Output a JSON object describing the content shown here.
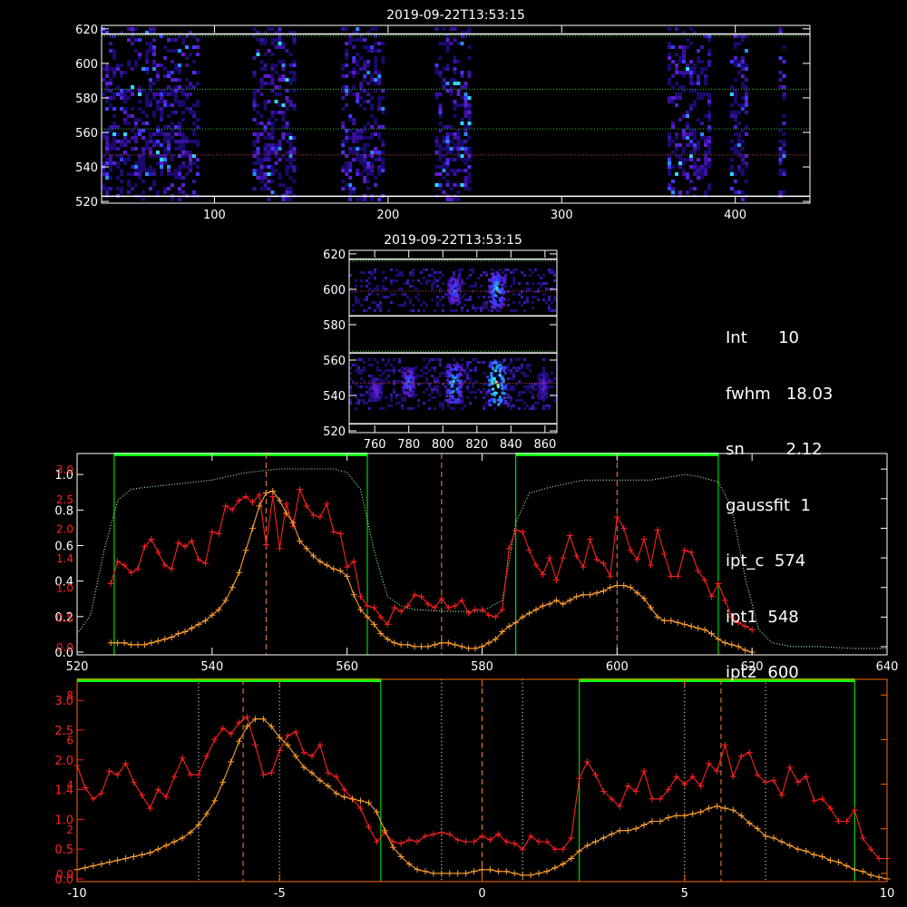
{
  "colors": {
    "background": "#000000",
    "axes": "#ffffff",
    "axes_bottom": "#ff6a00",
    "profile_red": "#ff2020",
    "profile_orange": "#ffa030",
    "guide_green": "#00ff00",
    "spectrum_green": "#b0ffb0",
    "center_line": "#ff8040"
  },
  "chart_data": [
    {
      "id": "image-wide",
      "type": "heatmap",
      "title": "2019-09-22T13:53:15",
      "xlim": [
        35,
        443
      ],
      "ylim": [
        519,
        622
      ],
      "xticks": [
        100,
        200,
        300,
        400
      ],
      "yticks": [
        520,
        540,
        560,
        580,
        600,
        620
      ],
      "colormap": [
        "#1a0a6e",
        "#5a1ed0",
        "#3c3cff",
        "#2aa0ff",
        "#40ffff",
        "#c0ff60"
      ],
      "bands_x": [
        [
          35,
          90
        ],
        [
          122,
          146
        ],
        [
          173,
          198
        ],
        [
          227,
          246
        ],
        [
          361,
          386
        ],
        [
          397,
          406
        ],
        [
          425,
          429
        ]
      ],
      "bands_y": [
        [
          522,
          616
        ]
      ],
      "dotted_rows_y": [
        616,
        585,
        562,
        547
      ],
      "white_rows_y": [
        617,
        523
      ]
    },
    {
      "id": "image-zoom",
      "type": "heatmap",
      "title": "2019-09-22T13:53:15",
      "xlim": [
        745,
        867
      ],
      "ylim": [
        519,
        622
      ],
      "xticks": [
        760,
        780,
        800,
        820,
        840,
        860
      ],
      "yticks": [
        520,
        540,
        560,
        580,
        600,
        620
      ],
      "blobs": [
        {
          "x": 831,
          "y": 548,
          "w": 6,
          "h": 16,
          "level": 5
        },
        {
          "x": 806,
          "y": 547,
          "w": 5,
          "h": 14,
          "level": 4
        },
        {
          "x": 831,
          "y": 600,
          "w": 5,
          "h": 12,
          "level": 4
        },
        {
          "x": 806,
          "y": 600,
          "w": 4,
          "h": 10,
          "level": 3
        },
        {
          "x": 779,
          "y": 548,
          "w": 4,
          "h": 10,
          "level": 3
        },
        {
          "x": 858,
          "y": 546,
          "w": 3,
          "h": 9,
          "level": 2
        },
        {
          "x": 760,
          "y": 544,
          "w": 4,
          "h": 8,
          "level": 2
        }
      ],
      "dotted_rows_y": [
        616,
        599,
        585,
        565,
        547
      ],
      "white_rows_y": [
        617,
        585,
        564,
        524
      ]
    },
    {
      "id": "profile-pixel",
      "type": "line",
      "xlim": [
        520,
        640
      ],
      "xticks": [
        520,
        540,
        560,
        580,
        600,
        620,
        640
      ],
      "ylim_left": [
        0,
        1.0
      ],
      "yticks_left": [
        "0.0",
        "0.2",
        "0.4",
        "0.6",
        "0.8",
        "1.0"
      ],
      "yticks_red": [
        "0.0",
        "0.5",
        "1.0",
        "1.4",
        "2.0",
        "2.5",
        "3.0"
      ],
      "vlines": [
        548,
        574,
        600
      ],
      "green_windows": [
        [
          525.5,
          563
        ],
        [
          585,
          615
        ]
      ],
      "green_curve": {
        "x": [
          520,
          522,
          524,
          526,
          528,
          530,
          535,
          540,
          545,
          550,
          555,
          558,
          560,
          562,
          564,
          566,
          568,
          570,
          575,
          580,
          583,
          585,
          587,
          590,
          595,
          600,
          605,
          610,
          612,
          615,
          617,
          619,
          621,
          623,
          626,
          630,
          635,
          640
        ],
        "y": [
          0.1,
          0.2,
          0.55,
          0.82,
          0.88,
          0.89,
          0.91,
          0.93,
          0.97,
          0.99,
          0.99,
          0.99,
          0.97,
          0.88,
          0.55,
          0.3,
          0.25,
          0.23,
          0.22,
          0.22,
          0.28,
          0.7,
          0.86,
          0.89,
          0.93,
          0.93,
          0.93,
          0.96,
          0.95,
          0.92,
          0.78,
          0.4,
          0.12,
          0.05,
          0.03,
          0.03,
          0.02,
          0.02
        ]
      },
      "series_red": {
        "x": [
          525,
          526,
          527,
          528,
          529,
          530,
          531,
          532,
          533,
          534,
          535,
          536,
          537,
          538,
          539,
          540,
          541,
          542,
          543,
          544,
          545,
          546,
          547,
          548,
          549,
          550,
          551,
          552,
          553,
          554,
          555,
          556,
          557,
          558,
          559,
          560,
          561,
          562,
          563,
          564,
          565,
          566,
          567,
          568,
          569,
          570,
          571,
          572,
          573,
          574,
          575,
          576,
          577,
          578,
          579,
          580,
          581,
          582,
          583,
          584,
          585,
          586,
          587,
          588,
          589,
          590,
          591,
          592,
          593,
          594,
          595,
          596,
          597,
          598,
          599,
          600,
          601,
          602,
          603,
          604,
          605,
          606,
          607,
          608,
          609,
          610,
          611,
          612,
          613,
          614,
          615,
          616,
          617,
          618,
          619,
          620
        ],
        "y": [
          0.37,
          0.49,
          0.47,
          0.43,
          0.45,
          0.57,
          0.61,
          0.54,
          0.47,
          0.45,
          0.59,
          0.57,
          0.6,
          0.5,
          0.48,
          0.65,
          0.64,
          0.79,
          0.77,
          0.82,
          0.84,
          0.81,
          0.85,
          0.58,
          0.84,
          0.56,
          0.8,
          0.68,
          0.88,
          0.79,
          0.74,
          0.73,
          0.8,
          0.65,
          0.64,
          0.46,
          0.49,
          0.3,
          0.25,
          0.24,
          0.19,
          0.15,
          0.24,
          0.22,
          0.25,
          0.31,
          0.3,
          0.26,
          0.24,
          0.29,
          0.24,
          0.25,
          0.28,
          0.21,
          0.23,
          0.23,
          0.2,
          0.19,
          0.23,
          0.56,
          0.66,
          0.65,
          0.55,
          0.47,
          0.42,
          0.51,
          0.39,
          0.51,
          0.63,
          0.52,
          0.46,
          0.61,
          0.5,
          0.48,
          0.41,
          0.73,
          0.67,
          0.55,
          0.5,
          0.61,
          0.47,
          0.66,
          0.53,
          0.41,
          0.41,
          0.55,
          0.54,
          0.44,
          0.39,
          0.3,
          0.37,
          0.28,
          0.19,
          0.16,
          0.14,
          0.12
        ]
      },
      "series_orange": {
        "x": [
          525,
          526,
          527,
          528,
          529,
          530,
          531,
          532,
          533,
          534,
          535,
          536,
          537,
          538,
          539,
          540,
          541,
          542,
          543,
          544,
          545,
          546,
          547,
          548,
          549,
          550,
          551,
          552,
          553,
          554,
          555,
          556,
          557,
          558,
          559,
          560,
          561,
          562,
          563,
          564,
          565,
          566,
          567,
          568,
          569,
          570,
          571,
          572,
          573,
          574,
          575,
          576,
          577,
          578,
          579,
          580,
          581,
          582,
          583,
          584,
          585,
          586,
          587,
          588,
          589,
          590,
          591,
          592,
          593,
          594,
          595,
          596,
          597,
          598,
          599,
          600,
          601,
          602,
          603,
          604,
          605,
          606,
          607,
          608,
          609,
          610,
          611,
          612,
          613,
          614,
          615,
          616,
          617,
          618,
          619,
          620
        ],
        "y": [
          0.05,
          0.05,
          0.05,
          0.04,
          0.04,
          0.04,
          0.05,
          0.06,
          0.07,
          0.08,
          0.1,
          0.11,
          0.13,
          0.15,
          0.17,
          0.2,
          0.23,
          0.28,
          0.35,
          0.43,
          0.55,
          0.67,
          0.79,
          0.86,
          0.87,
          0.82,
          0.75,
          0.7,
          0.6,
          0.56,
          0.52,
          0.49,
          0.47,
          0.45,
          0.44,
          0.41,
          0.31,
          0.23,
          0.19,
          0.15,
          0.1,
          0.07,
          0.05,
          0.04,
          0.04,
          0.03,
          0.03,
          0.03,
          0.04,
          0.05,
          0.05,
          0.04,
          0.03,
          0.02,
          0.02,
          0.03,
          0.05,
          0.07,
          0.11,
          0.14,
          0.16,
          0.19,
          0.21,
          0.23,
          0.25,
          0.26,
          0.28,
          0.26,
          0.28,
          0.3,
          0.31,
          0.31,
          0.32,
          0.33,
          0.35,
          0.36,
          0.36,
          0.35,
          0.32,
          0.29,
          0.24,
          0.19,
          0.17,
          0.17,
          0.16,
          0.15,
          0.14,
          0.13,
          0.12,
          0.1,
          0.07,
          0.05,
          0.04,
          0.03,
          0.01,
          0.0
        ]
      }
    },
    {
      "id": "profile-arcsec",
      "type": "line",
      "xlim": [
        -10,
        10
      ],
      "xticks": [
        -10,
        -5,
        0,
        5,
        10
      ],
      "yticks_left": [
        "0.0",
        "0.5",
        "1.0",
        "1.4",
        "2.0",
        "2.5",
        "3.0"
      ],
      "yticks_red": [
        "0.0",
        "2",
        "4",
        "6",
        "8"
      ],
      "vlines_dashed": [
        -5.9,
        0,
        5.9
      ],
      "vlines_dotted": [
        -7,
        -5,
        -1,
        1,
        5,
        7
      ],
      "green_windows": [
        [
          -10,
          -2.5
        ],
        [
          2.4,
          9.2
        ]
      ],
      "series_red": {
        "x": [
          -10.0,
          -9.8,
          -9.6,
          -9.4,
          -9.2,
          -9.0,
          -8.8,
          -8.6,
          -8.4,
          -8.2,
          -8.0,
          -7.8,
          -7.6,
          -7.4,
          -7.2,
          -7.0,
          -6.8,
          -6.6,
          -6.4,
          -6.2,
          -6.0,
          -5.8,
          -5.6,
          -5.4,
          -5.2,
          -5.0,
          -4.8,
          -4.6,
          -4.4,
          -4.2,
          -4.0,
          -3.8,
          -3.6,
          -3.4,
          -3.2,
          -3.0,
          -2.8,
          -2.6,
          -2.4,
          -2.2,
          -2.0,
          -1.8,
          -1.6,
          -1.4,
          -1.2,
          -1.0,
          -0.8,
          -0.6,
          -0.4,
          -0.2,
          0.0,
          0.2,
          0.4,
          0.6,
          0.8,
          1.0,
          1.2,
          1.4,
          1.6,
          1.8,
          2.0,
          2.2,
          2.4,
          2.6,
          2.8,
          3.0,
          3.2,
          3.4,
          3.6,
          3.8,
          4.0,
          4.2,
          4.4,
          4.6,
          4.8,
          5.0,
          5.2,
          5.4,
          5.6,
          5.8,
          6.0,
          6.2,
          6.4,
          6.6,
          6.8,
          7.0,
          7.2,
          7.4,
          7.6,
          7.8,
          8.0,
          8.2,
          8.4,
          8.6,
          8.8,
          9.0,
          9.2,
          9.4,
          9.6,
          9.8,
          10.0
        ],
        "y": [
          0.61,
          0.49,
          0.43,
          0.46,
          0.58,
          0.56,
          0.62,
          0.52,
          0.45,
          0.38,
          0.48,
          0.44,
          0.55,
          0.65,
          0.56,
          0.56,
          0.66,
          0.75,
          0.81,
          0.78,
          0.84,
          0.87,
          0.72,
          0.56,
          0.57,
          0.69,
          0.77,
          0.79,
          0.68,
          0.66,
          0.72,
          0.57,
          0.55,
          0.48,
          0.43,
          0.38,
          0.28,
          0.2,
          0.25,
          0.2,
          0.19,
          0.21,
          0.2,
          0.23,
          0.24,
          0.25,
          0.24,
          0.21,
          0.2,
          0.2,
          0.23,
          0.21,
          0.24,
          0.2,
          0.19,
          0.16,
          0.23,
          0.2,
          0.2,
          0.16,
          0.16,
          0.22,
          0.54,
          0.63,
          0.56,
          0.47,
          0.43,
          0.39,
          0.5,
          0.47,
          0.58,
          0.43,
          0.43,
          0.48,
          0.55,
          0.51,
          0.55,
          0.5,
          0.62,
          0.58,
          0.72,
          0.55,
          0.66,
          0.68,
          0.56,
          0.52,
          0.53,
          0.45,
          0.6,
          0.52,
          0.55,
          0.42,
          0.43,
          0.38,
          0.31,
          0.31,
          0.37,
          0.22,
          0.16,
          0.11,
          0.11
        ]
      },
      "series_orange": {
        "x": [
          -10.0,
          -9.8,
          -9.6,
          -9.4,
          -9.2,
          -9.0,
          -8.8,
          -8.6,
          -8.4,
          -8.2,
          -8.0,
          -7.8,
          -7.6,
          -7.4,
          -7.2,
          -7.0,
          -6.8,
          -6.6,
          -6.4,
          -6.2,
          -6.0,
          -5.8,
          -5.6,
          -5.4,
          -5.2,
          -5.0,
          -4.8,
          -4.6,
          -4.4,
          -4.2,
          -4.0,
          -3.8,
          -3.6,
          -3.4,
          -3.2,
          -3.0,
          -2.8,
          -2.6,
          -2.4,
          -2.2,
          -2.0,
          -1.8,
          -1.6,
          -1.4,
          -1.2,
          -1.0,
          -0.8,
          -0.6,
          -0.4,
          -0.2,
          0.0,
          0.2,
          0.4,
          0.6,
          0.8,
          1.0,
          1.2,
          1.4,
          1.6,
          1.8,
          2.0,
          2.2,
          2.4,
          2.6,
          2.8,
          3.0,
          3.2,
          3.4,
          3.6,
          3.8,
          4.0,
          4.2,
          4.4,
          4.6,
          4.8,
          5.0,
          5.2,
          5.4,
          5.6,
          5.8,
          6.0,
          6.2,
          6.4,
          6.6,
          6.8,
          7.0,
          7.2,
          7.4,
          7.6,
          7.8,
          8.0,
          8.2,
          8.4,
          8.6,
          8.8,
          9.0,
          9.2,
          9.4,
          9.6,
          9.8,
          10.0
        ],
        "y": [
          0.05,
          0.06,
          0.07,
          0.08,
          0.09,
          0.1,
          0.11,
          0.12,
          0.13,
          0.14,
          0.16,
          0.18,
          0.2,
          0.22,
          0.25,
          0.29,
          0.35,
          0.42,
          0.52,
          0.63,
          0.74,
          0.82,
          0.86,
          0.86,
          0.82,
          0.76,
          0.72,
          0.66,
          0.6,
          0.57,
          0.53,
          0.5,
          0.46,
          0.44,
          0.43,
          0.42,
          0.41,
          0.36,
          0.26,
          0.17,
          0.12,
          0.08,
          0.05,
          0.04,
          0.03,
          0.03,
          0.03,
          0.03,
          0.03,
          0.04,
          0.05,
          0.05,
          0.04,
          0.04,
          0.03,
          0.02,
          0.02,
          0.03,
          0.04,
          0.06,
          0.08,
          0.11,
          0.15,
          0.18,
          0.2,
          0.22,
          0.24,
          0.26,
          0.26,
          0.27,
          0.29,
          0.31,
          0.31,
          0.33,
          0.34,
          0.34,
          0.35,
          0.36,
          0.38,
          0.39,
          0.38,
          0.37,
          0.34,
          0.3,
          0.27,
          0.23,
          0.22,
          0.2,
          0.18,
          0.16,
          0.15,
          0.13,
          0.12,
          0.1,
          0.09,
          0.07,
          0.05,
          0.04,
          0.02,
          0.01,
          0.0
        ]
      }
    }
  ],
  "info": {
    "lines": [
      "Int      10",
      "fwhm   18.03",
      "sn        2.12",
      "gaussfit  1",
      "ipt_c  574",
      "ipt1  548",
      "ipt2  600"
    ]
  }
}
